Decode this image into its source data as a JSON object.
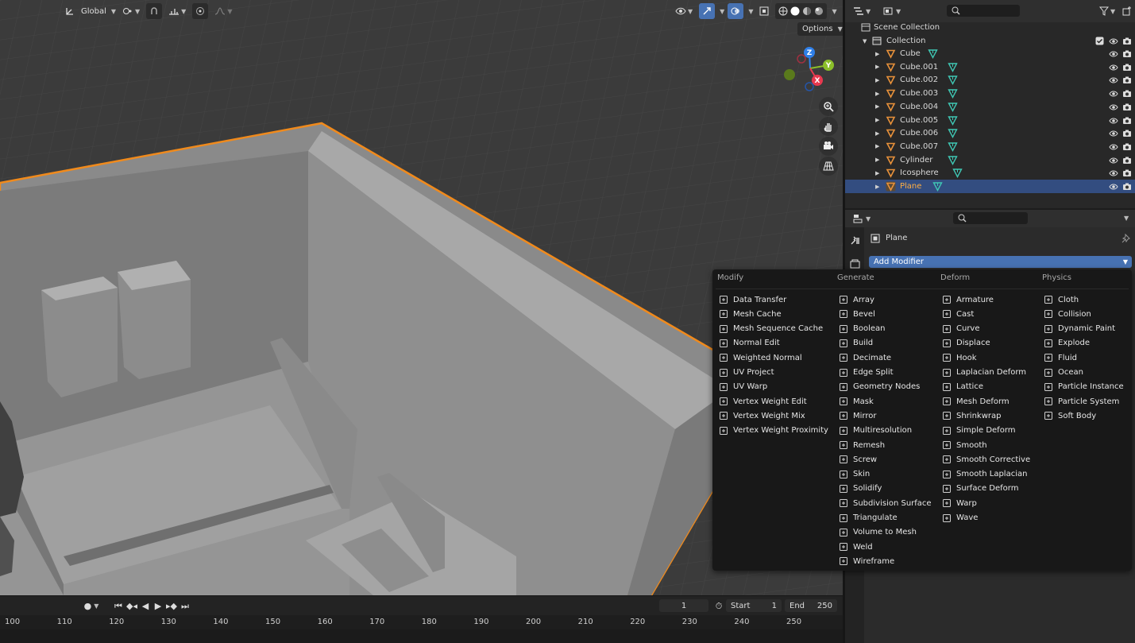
{
  "viewport": {
    "transform_orientation": "Global",
    "options_label": "Options",
    "gizmo_axes": {
      "z": "Z",
      "y": "Y",
      "x": "X"
    },
    "nav_tools": [
      "zoom-icon",
      "hand-pan-icon",
      "camera-view-icon",
      "ortho-grid-icon"
    ]
  },
  "timeline": {
    "current_frame": "1",
    "start_label": "Start",
    "start_value": "1",
    "end_label": "End",
    "end_value": "250",
    "ruler_ticks": [
      "100",
      "110",
      "120",
      "130",
      "140",
      "150",
      "160",
      "170",
      "180",
      "190",
      "200",
      "210",
      "220",
      "230",
      "240",
      "250"
    ]
  },
  "outliner": {
    "scene_collection": "Scene Collection",
    "collection": "Collection",
    "objects": [
      "Cube",
      "Cube.001",
      "Cube.002",
      "Cube.003",
      "Cube.004",
      "Cube.005",
      "Cube.006",
      "Cube.007",
      "Cylinder",
      "Icosphere",
      "Plane"
    ],
    "selected": "Plane"
  },
  "properties": {
    "object_name": "Plane",
    "add_modifier": "Add Modifier"
  },
  "menu": {
    "columns": [
      {
        "title": "Modify",
        "items": [
          "Data Transfer",
          "Mesh Cache",
          "Mesh Sequence Cache",
          "Normal Edit",
          "Weighted Normal",
          "UV Project",
          "UV Warp",
          "Vertex Weight Edit",
          "Vertex Weight Mix",
          "Vertex Weight Proximity"
        ]
      },
      {
        "title": "Generate",
        "items": [
          "Array",
          "Bevel",
          "Boolean",
          "Build",
          "Decimate",
          "Edge Split",
          "Geometry Nodes",
          "Mask",
          "Mirror",
          "Multiresolution",
          "Remesh",
          "Screw",
          "Skin",
          "Solidify",
          "Subdivision Surface",
          "Triangulate",
          "Volume to Mesh",
          "Weld",
          "Wireframe"
        ]
      },
      {
        "title": "Deform",
        "items": [
          "Armature",
          "Cast",
          "Curve",
          "Displace",
          "Hook",
          "Laplacian Deform",
          "Lattice",
          "Mesh Deform",
          "Shrinkwrap",
          "Simple Deform",
          "Smooth",
          "Smooth Corrective",
          "Smooth Laplacian",
          "Surface Deform",
          "Warp",
          "Wave"
        ]
      },
      {
        "title": "Physics",
        "items": [
          "Cloth",
          "Collision",
          "Dynamic Paint",
          "Explode",
          "Fluid",
          "Ocean",
          "Particle Instance",
          "Particle System",
          "Soft Body"
        ]
      }
    ]
  },
  "colors": {
    "accent_blue": "#4772b3",
    "selection_orange": "#ffae42",
    "outline_orange": "#f08a1c",
    "mesh_green": "#3fc7b4",
    "axis_x": "#e8394f",
    "axis_y": "#8bbf2a",
    "axis_z": "#2f7fe8"
  }
}
